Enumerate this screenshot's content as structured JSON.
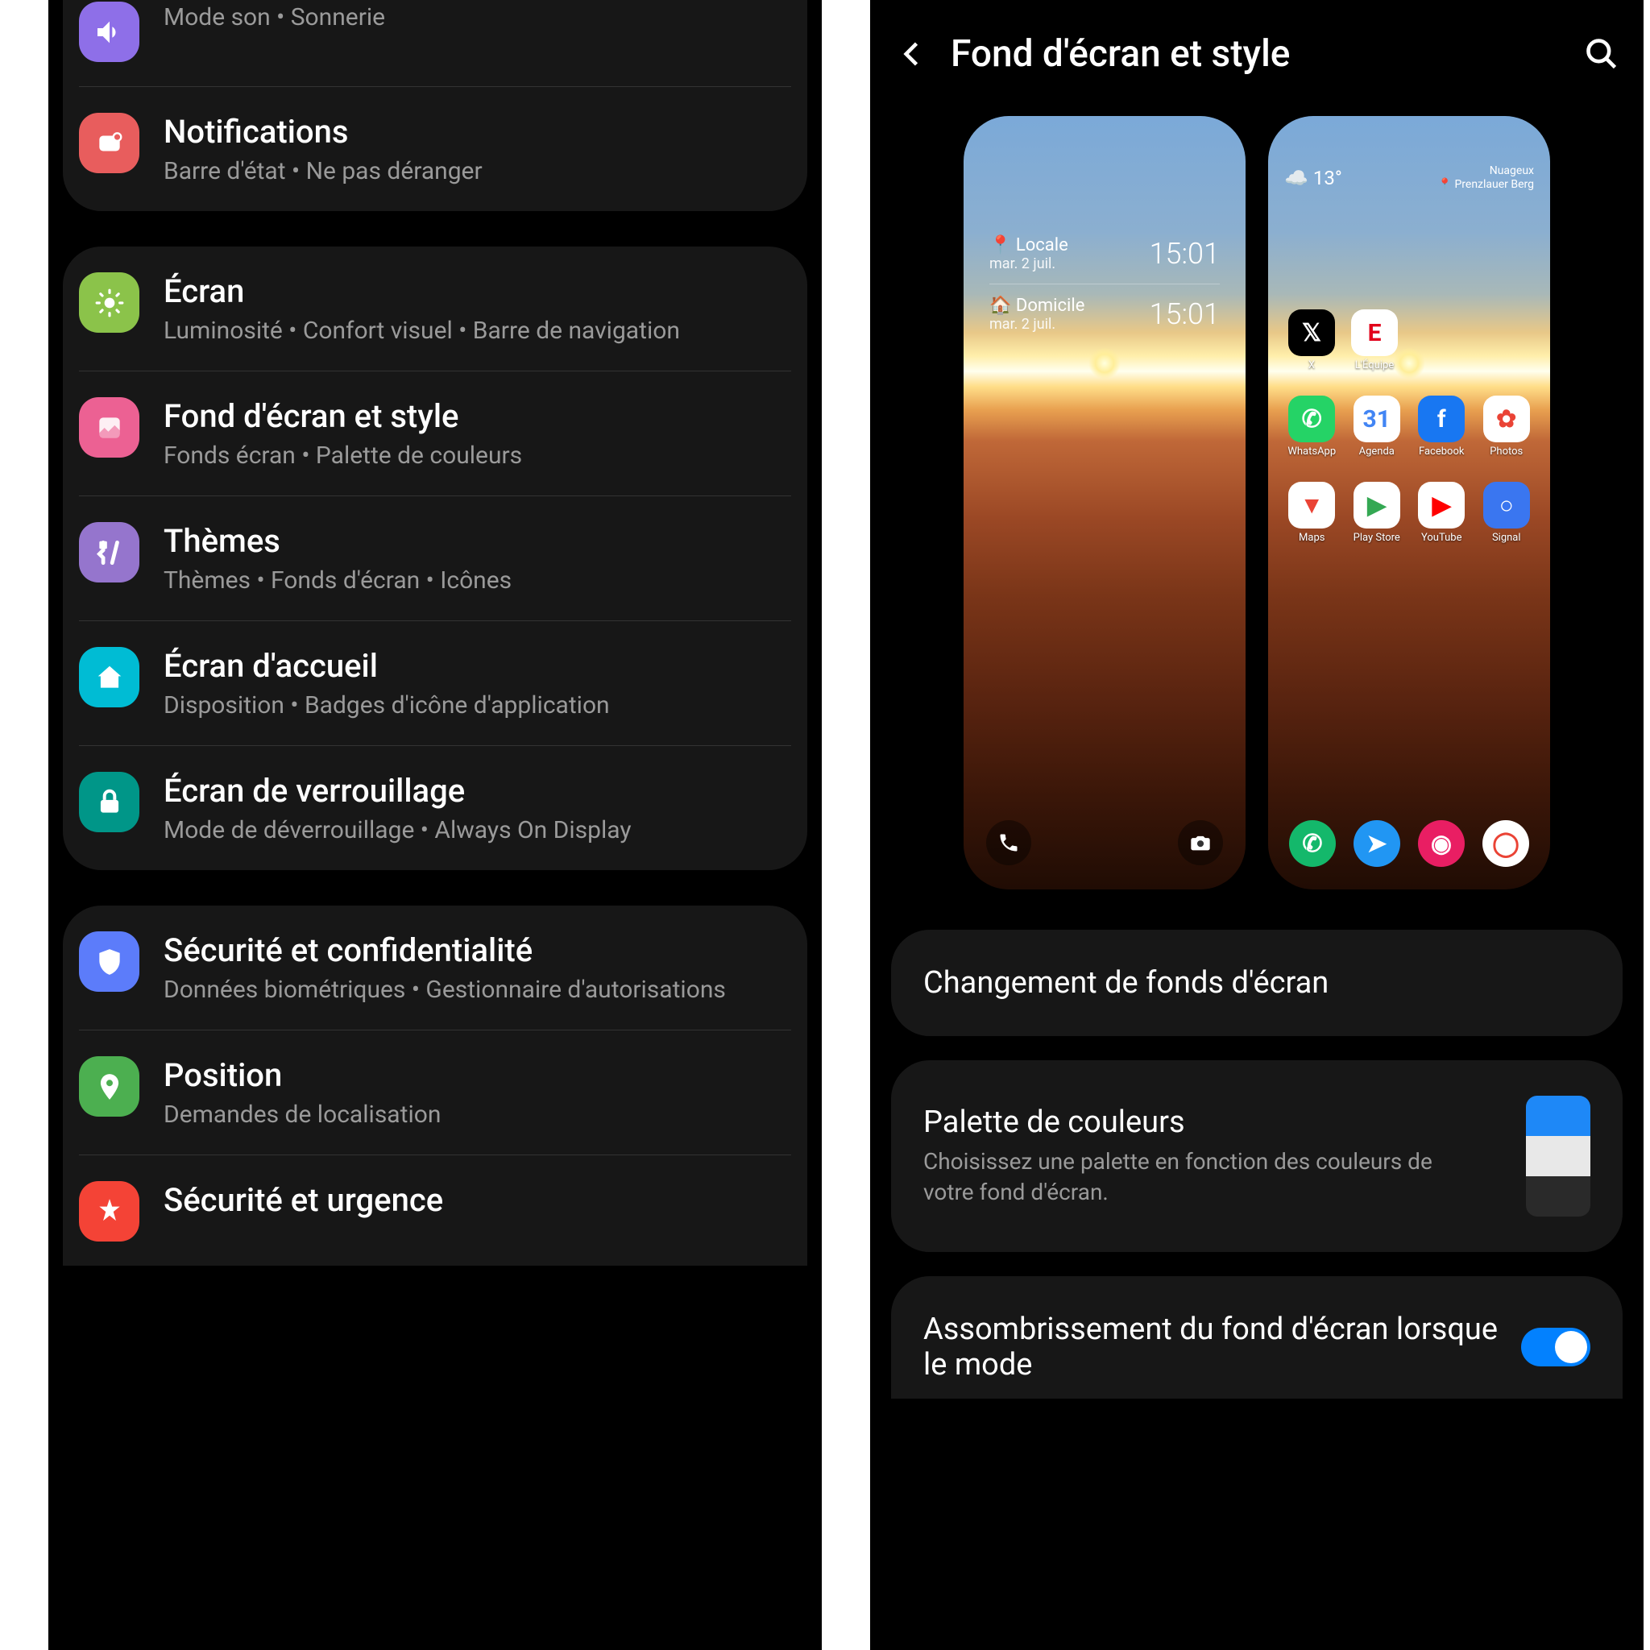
{
  "left": {
    "group1": {
      "sound": {
        "title": "",
        "sub": "Mode son  •  Sonnerie"
      },
      "notifications": {
        "title": "Notifications",
        "sub": "Barre d'état  •  Ne pas déranger"
      }
    },
    "group2": {
      "display": {
        "title": "Écran",
        "sub": "Luminosité  •  Confort visuel  •  Barre de navigation"
      },
      "wallpaper": {
        "title": "Fond d'écran et style",
        "sub": "Fonds écran  •  Palette de couleurs"
      },
      "themes": {
        "title": "Thèmes",
        "sub": "Thèmes  •  Fonds d'écran  •  Icônes"
      },
      "home": {
        "title": "Écran d'accueil",
        "sub": "Disposition  •  Badges d'icône d'application"
      },
      "lock": {
        "title": "Écran de verrouillage",
        "sub": "Mode de déverrouillage  •  Always On Display"
      }
    },
    "group3": {
      "security": {
        "title": "Sécurité et confidentialité",
        "sub": "Données biométriques  •  Gestionnaire d'autorisations"
      },
      "location": {
        "title": "Position",
        "sub": "Demandes de localisation"
      },
      "safety": {
        "title": "Sécurité et urgence",
        "sub": ""
      }
    }
  },
  "right": {
    "header": "Fond d'écran et style",
    "lock_preview": {
      "line1_label": "Locale",
      "line1_sub": "mar. 2 juil.",
      "line1_time": "15:01",
      "line2_label": "Domicile",
      "line2_sub": "mar. 2 juil.",
      "line2_time": "15:01"
    },
    "home_preview": {
      "temp": "13°",
      "weather": "Nuageux",
      "location": "Prenzlauer Berg",
      "apps_row1": [
        {
          "name": "X",
          "bg": "#000",
          "fg": "#fff",
          "glyph": "𝕏"
        },
        {
          "name": "L'Équipe",
          "bg": "#fff",
          "fg": "#E2001A",
          "glyph": "E"
        }
      ],
      "apps_grid": [
        {
          "name": "WhatsApp",
          "bg": "#25D366",
          "fg": "#fff",
          "glyph": "✆"
        },
        {
          "name": "Agenda",
          "bg": "#fff",
          "fg": "#4285F4",
          "glyph": "31"
        },
        {
          "name": "Facebook",
          "bg": "#1877F2",
          "fg": "#fff",
          "glyph": "f"
        },
        {
          "name": "Photos",
          "bg": "#fff",
          "fg": "#EA4335",
          "glyph": "✿"
        },
        {
          "name": "Maps",
          "bg": "#fff",
          "fg": "#EA4335",
          "glyph": "▼"
        },
        {
          "name": "Play Store",
          "bg": "#fff",
          "fg": "#34A853",
          "glyph": "▶"
        },
        {
          "name": "YouTube",
          "bg": "#fff",
          "fg": "#FF0000",
          "glyph": "▶"
        },
        {
          "name": "Signal",
          "bg": "#3A76F0",
          "fg": "#fff",
          "glyph": "○"
        }
      ],
      "dock": [
        {
          "bg": "#14B86B",
          "fg": "#fff",
          "glyph": "✆"
        },
        {
          "bg": "#2196F3",
          "fg": "#fff",
          "glyph": "➤"
        },
        {
          "bg": "#E91E63",
          "fg": "#fff",
          "glyph": "◉"
        },
        {
          "bg": "#fff",
          "fg": "#EA4335",
          "glyph": "◯"
        }
      ]
    },
    "change": "Changement de fonds d'écran",
    "palette": {
      "title": "Palette de couleurs",
      "sub": "Choisissez une palette en fonction des couleurs de votre fond d'écran."
    },
    "darken": {
      "title": "Assombrissement du fond d'écran lorsque le mode"
    }
  },
  "colors": {
    "sound": "#8E6FE8",
    "notifications": "#E85D5D",
    "display": "#8BC34A",
    "wallpaper": "#EC6193",
    "themes": "#9575CD",
    "home": "#00BCD4",
    "lock": "#009688",
    "security": "#5C7CFA",
    "location": "#4CAF50",
    "safety": "#F44336",
    "palette": [
      "#1E88F7",
      "#E8E8E8",
      "#2A2A2A"
    ]
  }
}
